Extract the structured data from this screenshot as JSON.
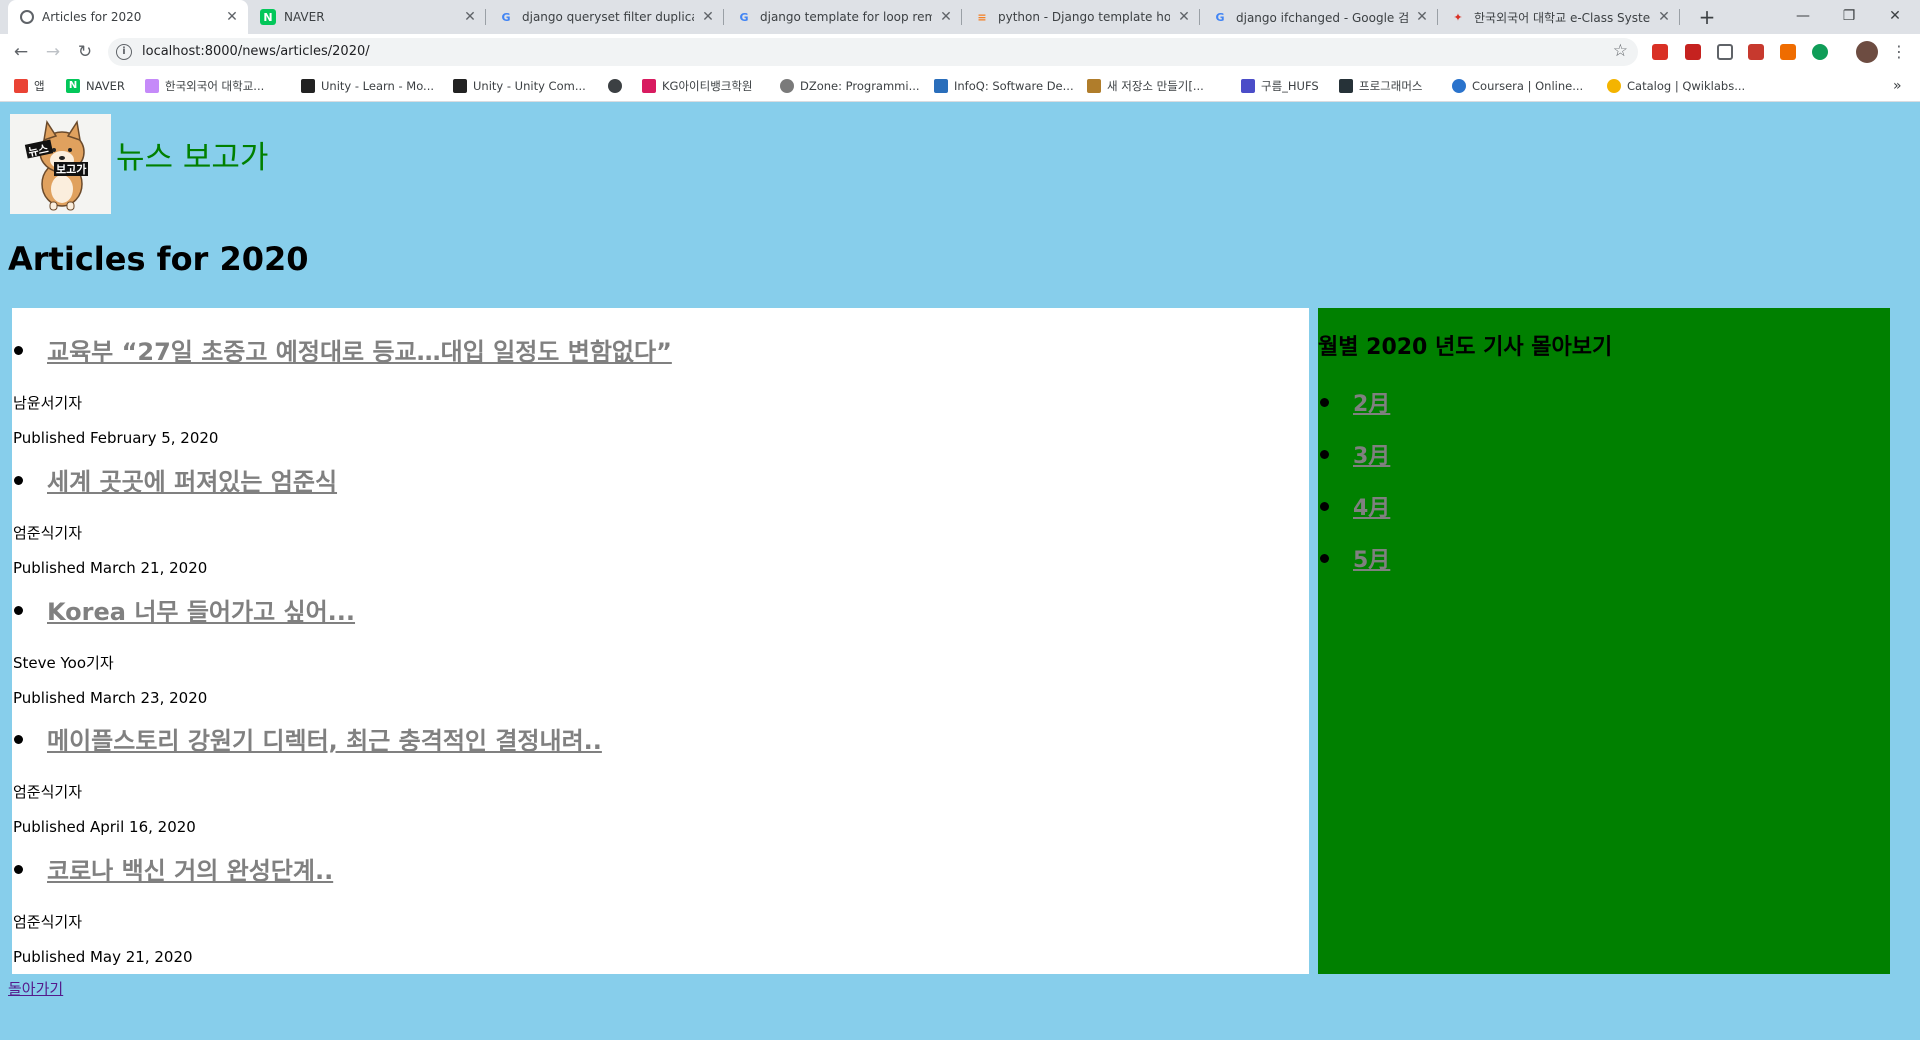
{
  "browser": {
    "tabs": [
      {
        "title": "Articles for 2020",
        "icon": "globe-icon",
        "active": true
      },
      {
        "title": "NAVER",
        "icon": "naver-icon"
      },
      {
        "title": "django queryset filter duplicate",
        "icon": "google-icon"
      },
      {
        "title": "django template for loop remov",
        "icon": "google-icon"
      },
      {
        "title": "python - Django template how",
        "icon": "stackoverflow-icon"
      },
      {
        "title": "django ifchanged - Google 검색",
        "icon": "google-icon"
      },
      {
        "title": "한국외국어 대학교 e-Class Syste",
        "icon": "hufs-icon"
      }
    ],
    "url": "localhost:8000/news/articles/2020/",
    "bookmarks": [
      {
        "label": "앱",
        "color": "#ea4335"
      },
      {
        "label": "NAVER",
        "color": "#03c75a"
      },
      {
        "label": "한국외국어 대학교...",
        "color": "#c58af9"
      },
      {
        "label": "Unity - Learn - Mo...",
        "color": "#222222"
      },
      {
        "label": "Unity - Unity Com...",
        "color": "#222222"
      },
      {
        "label": "",
        "color": "#3c4043"
      },
      {
        "label": "KG아이티뱅크학원",
        "color": "#d81b60"
      },
      {
        "label": "DZone: Programmi...",
        "color": "#7a7a7a"
      },
      {
        "label": "InfoQ: Software De...",
        "color": "#2a6ebb"
      },
      {
        "label": "새 저장소 만들기[...",
        "color": "#b07d2b"
      },
      {
        "label": "구름_HUFS",
        "color": "#4b4dc8"
      },
      {
        "label": "프로그래머스",
        "color": "#263238"
      },
      {
        "label": "Coursera | Online...",
        "color": "#2a73cc"
      },
      {
        "label": "Catalog | Qwiklabs...",
        "color": "#f4b400"
      }
    ]
  },
  "site": {
    "title": "뉴스 보고가",
    "logo_text_top": "뉴스",
    "logo_text_bottom": "보고가"
  },
  "page": {
    "heading": "Articles for 2020",
    "articles": [
      {
        "title": "교육부 “27일 초중고 예정대로 등교…대입 일정도 변함없다”",
        "reporter": "남윤서기자",
        "published": "Published February 5, 2020"
      },
      {
        "title": "세계 곳곳에 퍼져있는 엄준식",
        "reporter": "엄준식기자",
        "published": "Published March 21, 2020"
      },
      {
        "title": "Korea 너무 들어가고 싶어...",
        "reporter": "Steve Yoo기자",
        "published": "Published March 23, 2020"
      },
      {
        "title": "메이플스토리 강원기 디렉터, 최근 충격적인 결정내려..",
        "reporter": "엄준식기자",
        "published": "Published April 16, 2020"
      },
      {
        "title": "코로나 백신 거의 완성단계..",
        "reporter": "엄준식기자",
        "published": "Published May 21, 2020"
      }
    ],
    "sidebar": {
      "heading": "월별 2020 년도 기사 몰아보기",
      "months": [
        "2月",
        "3月",
        "4月",
        "5月"
      ]
    },
    "back_link": "돌아가기"
  },
  "colors": {
    "page_background": "#87ceeb",
    "sidebar_background": "#008000",
    "site_title": "#008000",
    "article_link": "#808080",
    "visited_link": "#551a8b"
  }
}
